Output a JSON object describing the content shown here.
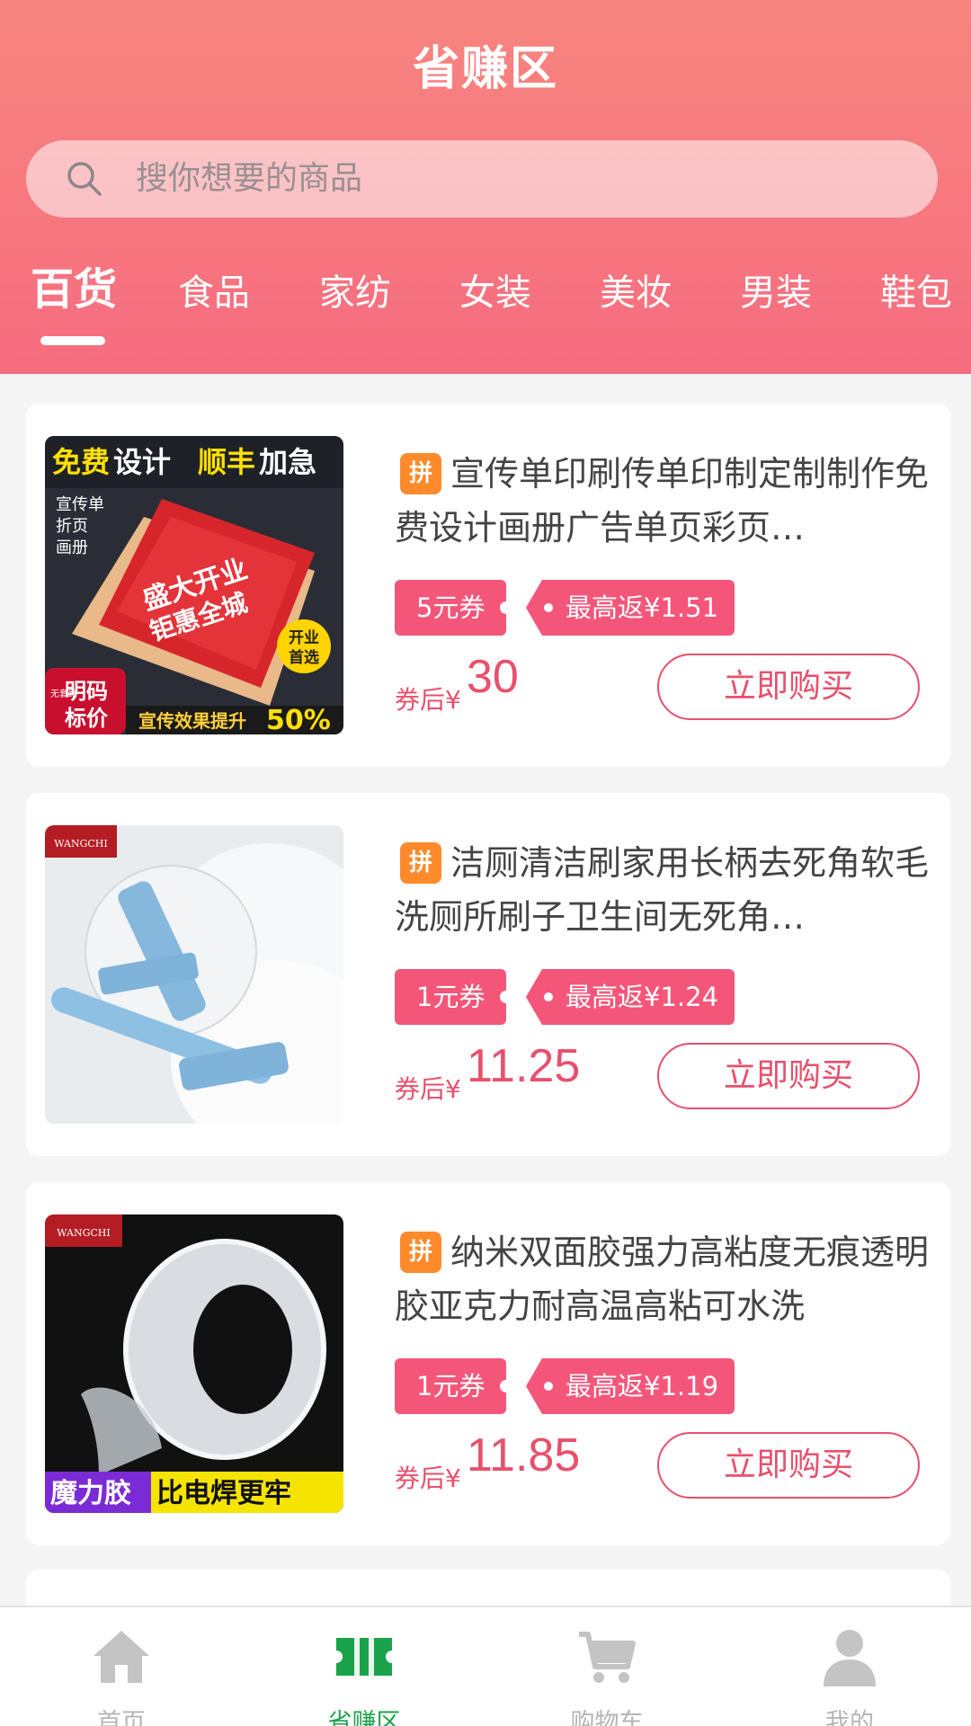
{
  "header": {
    "title": "省赚区",
    "search_placeholder": "搜你想要的商品"
  },
  "tabs": [
    {
      "label": "百货",
      "active": true
    },
    {
      "label": "食品"
    },
    {
      "label": "家纺"
    },
    {
      "label": "女装"
    },
    {
      "label": "美妆"
    },
    {
      "label": "男装"
    },
    {
      "label": "鞋包"
    }
  ],
  "products": [
    {
      "badge": "拼",
      "title": "宣传单印刷传单印制定制制作免费设计画册广告单页彩页…",
      "coupon": "5元券",
      "rebate": "最高返¥1.51",
      "after_label": "券后¥",
      "price": "30",
      "buy_label": "立即购买",
      "image": {
        "top_text_1": "免费",
        "top_text_2": "设计",
        "top_text_3": "顺丰",
        "top_text_4": "加急",
        "side_text_1": "宣传单",
        "side_text_2": "折页",
        "side_text_3": "画册",
        "flyer_text_1": "盛大开业",
        "flyer_text_2": "钜惠全城",
        "badge_text_1": "开业",
        "badge_text_2": "首选",
        "corner_text_1": "明码",
        "corner_text_2": "标价",
        "corner_small": "无套路",
        "footer_text": "宣传效果提升",
        "percent": "50%"
      }
    },
    {
      "badge": "拼",
      "title": "洁厕清洁刷家用长柄去死角软毛洗厕所刷子卫生间无死角…",
      "coupon": "1元券",
      "rebate": "最高返¥1.24",
      "after_label": "券后¥",
      "price": "11.25",
      "buy_label": "立即购买",
      "image": {
        "brand": "WANGCHI"
      }
    },
    {
      "badge": "拼",
      "title": "纳米双面胶强力高粘度无痕透明胶亚克力耐高温高粘可水洗",
      "coupon": "1元券",
      "rebate": "最高返¥1.19",
      "after_label": "券后¥",
      "price": "11.85",
      "buy_label": "立即购买",
      "image": {
        "brand": "WANGCHI",
        "footer_left": "魔力胶",
        "footer_right": "比电焊更牢"
      }
    }
  ],
  "bottom_nav": [
    {
      "label": "首页",
      "icon": "home-icon"
    },
    {
      "label": "省赚区",
      "icon": "ticket-icon",
      "active": true
    },
    {
      "label": "购物车",
      "icon": "cart-icon"
    },
    {
      "label": "我的",
      "icon": "user-icon"
    }
  ],
  "colors": {
    "header_top": "#f7857f",
    "accent": "#e8506c",
    "coupon": "#f4567a",
    "badge": "#ff8a2b",
    "nav_active": "#1aa34a"
  }
}
